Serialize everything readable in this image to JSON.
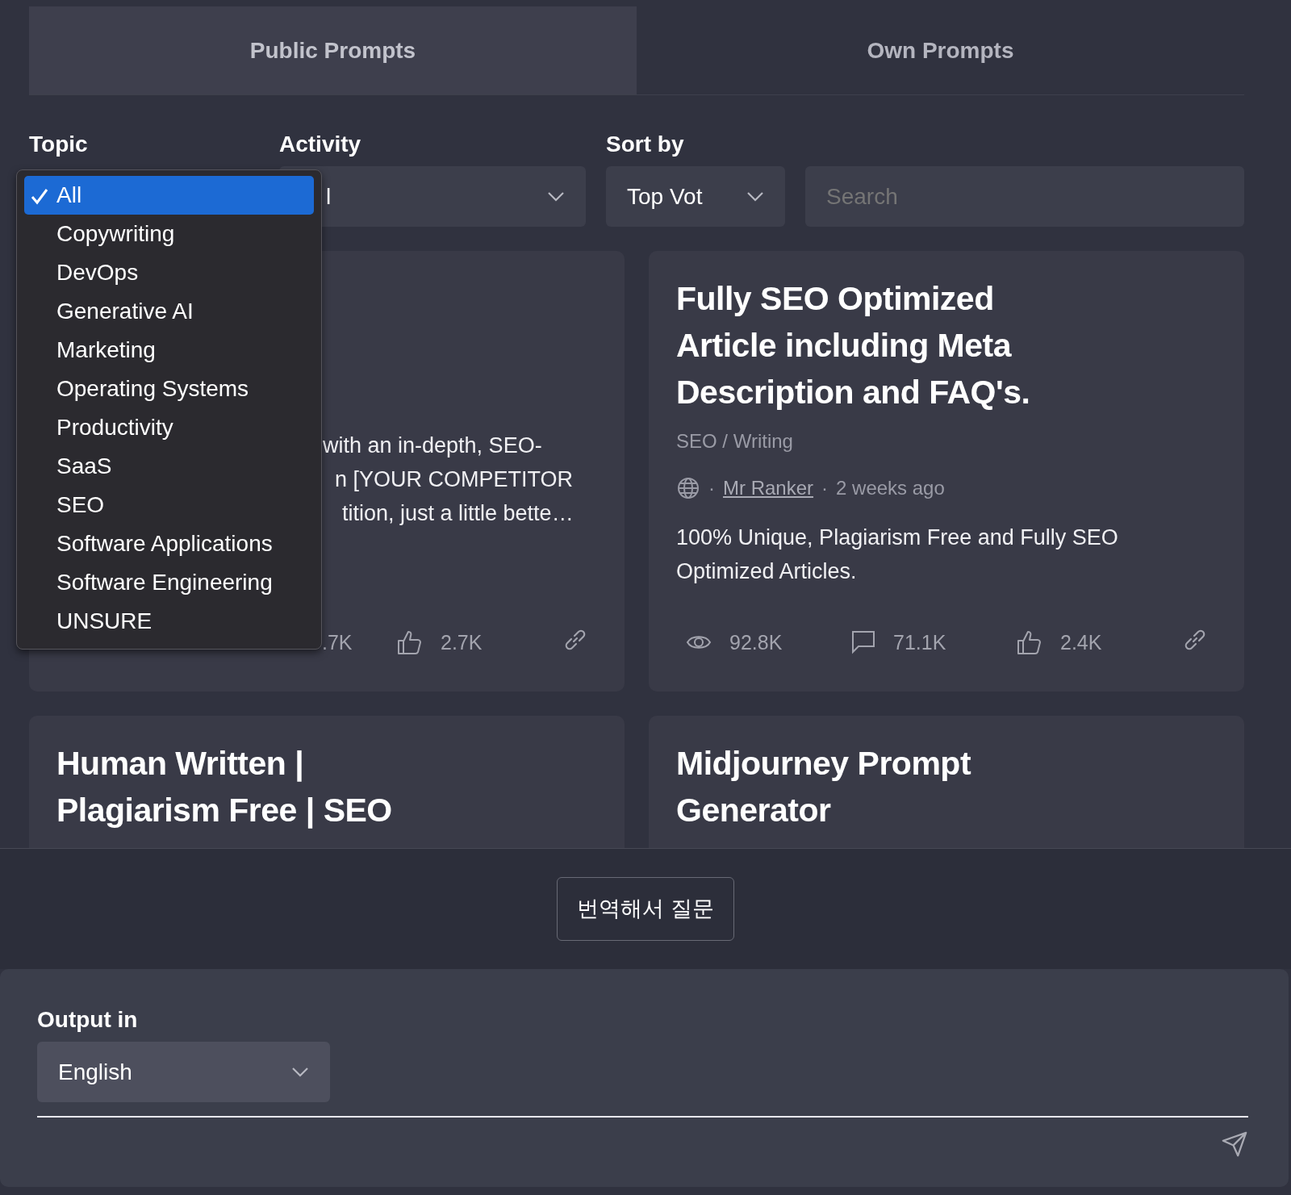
{
  "tabs": [
    {
      "label": "Public Prompts",
      "selected": true
    },
    {
      "label": "Own Prompts",
      "selected": false
    }
  ],
  "filters": {
    "topic": {
      "label": "Topic",
      "options": [
        {
          "label": "All",
          "selected": true
        },
        {
          "label": "Copywriting",
          "selected": false
        },
        {
          "label": "DevOps",
          "selected": false
        },
        {
          "label": "Generative AI",
          "selected": false
        },
        {
          "label": "Marketing",
          "selected": false
        },
        {
          "label": "Operating Systems",
          "selected": false
        },
        {
          "label": "Productivity",
          "selected": false
        },
        {
          "label": "SaaS",
          "selected": false
        },
        {
          "label": "SEO",
          "selected": false
        },
        {
          "label": "Software Applications",
          "selected": false
        },
        {
          "label": "Software Engineering",
          "selected": false
        },
        {
          "label": "UNSURE",
          "selected": false
        }
      ]
    },
    "activity": {
      "label": "Activity",
      "value": "l"
    },
    "sort": {
      "label": "Sort by",
      "value": "Top Vot"
    },
    "search": {
      "placeholder": "Search"
    }
  },
  "cards": [
    {
      "description_lines": [
        "with an in-depth, SEO-",
        "n [YOUR COMPETITOR",
        "tition, just a little bette…"
      ],
      "stats": [
        {
          "kind": "fragment",
          "value": ".7K"
        },
        {
          "kind": "likes",
          "value": "2.7K"
        },
        {
          "kind": "link"
        }
      ]
    },
    {
      "title": "Fully SEO Optimized Article including Meta Description and FAQ's.",
      "category": "SEO / Writing",
      "author": "Mr Ranker",
      "separators": [
        "·",
        "·"
      ],
      "time": "2 weeks ago",
      "description": "100% Unique, Plagiarism Free and Fully SEO Optimized Articles.",
      "stats": [
        {
          "kind": "views",
          "value": "92.8K"
        },
        {
          "kind": "comments",
          "value": "71.1K"
        },
        {
          "kind": "likes",
          "value": "2.4K"
        },
        {
          "kind": "link"
        }
      ]
    },
    {
      "title": "Human Written | Plagiarism Free | SEO"
    },
    {
      "title": "Midjourney Prompt Generator"
    }
  ],
  "translate_button": "번역해서 질문",
  "output": {
    "label": "Output in",
    "value": "English"
  }
}
